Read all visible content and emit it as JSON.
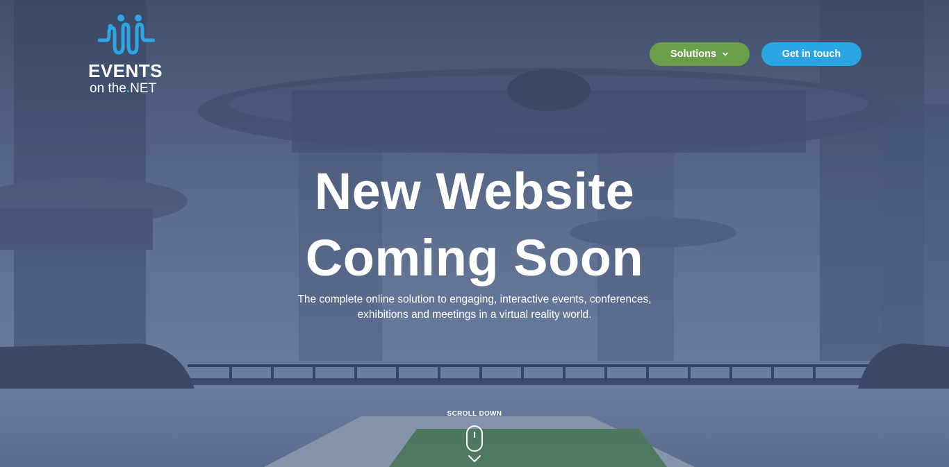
{
  "logo": {
    "events": "EVENTS",
    "on_the": "on the",
    "dot": ".",
    "net": "NET",
    "icon": "people-wave-icon"
  },
  "nav": {
    "solutions_label": "Solutions",
    "solutions_icon": "chevron-down-icon",
    "contact_label": "Get in touch"
  },
  "hero": {
    "title_line1": "New Website",
    "title_line2": "Coming Soon",
    "subtitle_line1": "The complete online solution to engaging, interactive events, conferences,",
    "subtitle_line2": "exhibitions and meetings in a virtual reality world."
  },
  "scroll": {
    "label": "SCROLL DOWN",
    "mouse_icon": "mouse-icon",
    "arrow_icon": "chevron-down-icon"
  },
  "colors": {
    "solutions_button": "#6b9e4a",
    "contact_button": "#29a5e1",
    "logo_accent": "#2ea6e4"
  }
}
